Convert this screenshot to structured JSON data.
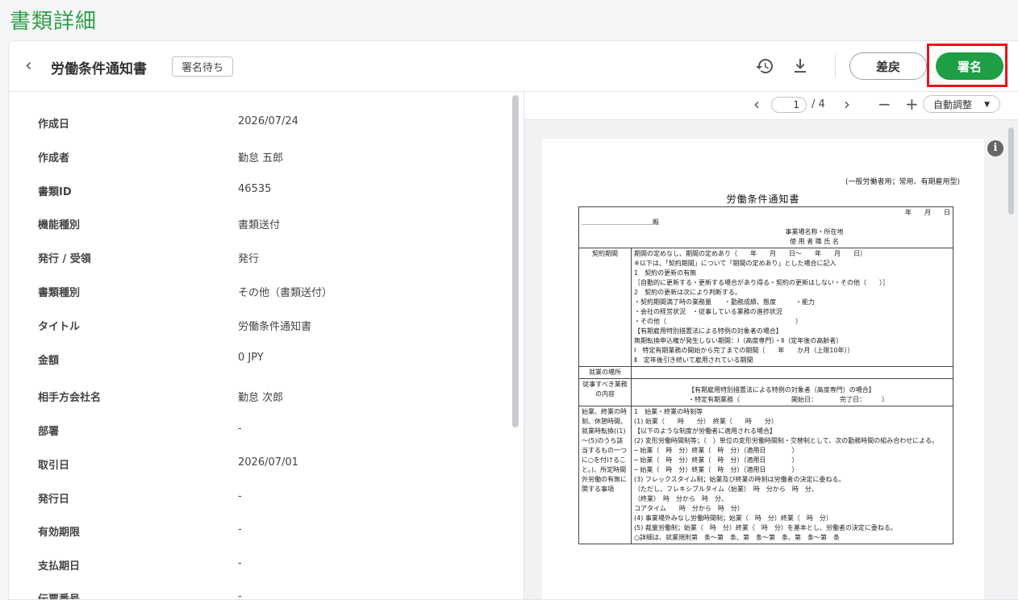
{
  "page_title": "書類詳細",
  "header": {
    "document_title": "労働条件通知書",
    "status_badge": "署名待ち",
    "return_label": "差戻",
    "sign_label": "署名"
  },
  "details": [
    {
      "key": "作成日",
      "value": "2026/07/24"
    },
    {
      "key": "作成者",
      "value": "勤怠 五郎"
    },
    {
      "key": "書類ID",
      "value": "46535"
    },
    {
      "key": "機能種別",
      "value": "書類送付"
    },
    {
      "key": "発行 / 受領",
      "value": "発行"
    },
    {
      "key": "書類種別",
      "value": "その他（書類送付）"
    },
    {
      "key": "タイトル",
      "value": "労働条件通知書"
    },
    {
      "key": "金額",
      "value": "0 JPY"
    },
    {
      "key": "相手方会社名",
      "value": "勤怠 次郎"
    },
    {
      "key": "部署",
      "value": "-"
    },
    {
      "key": "取引日",
      "value": "2026/07/01"
    },
    {
      "key": "発行日",
      "value": "-"
    },
    {
      "key": "有効期限",
      "value": "-"
    },
    {
      "key": "支払期日",
      "value": "-"
    },
    {
      "key": "伝票番号",
      "value": "-"
    }
  ],
  "viewer": {
    "current_page": "1",
    "total_pages": "/ 4",
    "zoom_label": "自動調整",
    "document": {
      "type_note": "(一般労働者用；常用、有期雇用型)",
      "heading": "労働条件通知書",
      "date_line": "年　　月　　日",
      "addressee": "＿＿＿＿＿＿＿＿＿＿＿殿",
      "employer_1": "事業場名称・所在地",
      "employer_2": "使 用 者 職 氏 名",
      "contract_label": "契約期間",
      "contract_lines": [
        "期間の定めなし、期間の定めあり（　　年　　月　　日～　　年　　月　　日）",
        "※以下は、「契約期間」について「期間の定めあり」とした場合に記入",
        "1　契約の更新の有無",
        "［自動的に更新する・更新する場合があり得る・契約の更新はしない・その他（　　）］",
        "2　契約の更新は次により判断する。",
        "・契約期間満了時の業務量　　・勤務成績、態度　　　・能力",
        "・会社の経営状況　・従事している業務の進捗状況",
        "・その他（　　　　　　　　　　　　　　　　　　　　）",
        "【有期雇用特別措置法による特例の対象者の場合】",
        "無期転換申込権が発生しない期間：Ⅰ（高度専門）・Ⅱ（定年後の高齢者）",
        "Ⅰ　特定有期業務の開始から完了までの期間（　　年　　か月（上限10年））",
        "Ⅱ　定年後引き続いて雇用されている期間"
      ],
      "workplace_label": "就業の場所",
      "duties_label": "従事すべき業務の内容",
      "duties_lines": [
        "【有期雇用特別措置法による特例の対象者（高度専門）の場合】",
        "・特定有期業務（　　　　　　　　開始日：　　　　完了日：　　　）"
      ],
      "hours_label": "始業、終業の時刻、休憩時間、就業時転換((1)～(5)のうち該当するもの一つに○を付けること。)、所定時間外労働の有無に関する事項",
      "hours_lines": [
        "1　始業・終業の時刻等",
        "(1) 始業（　　時　　分）　終業（　　時　　分）",
        "【以下のような制度が労働者に適用される場合】",
        "(2) 変形労働時間制等；（　）単位の変形労働時間制・交替制として、次の勤務時間の組み合わせによる。",
        "─ 始業（　時　分）終業（　時　分）（適用日　　　　）",
        "─ 始業（　時　分）終業（　時　分）（適用日　　　　）",
        "─ 始業（　時　分）終業（　時　分）（適用日　　　　）",
        "(3) フレックスタイム制；始業及び終業の時刻は労働者の決定に委ねる。",
        "（ただし、フレキシブルタイム（始業）　時　分から　時　分、",
        "（終業）　時　分から　時　分、",
        "コアタイム　　時　分から　時　分）",
        "(4) 事業場外みなし労働時間制；始業（　時　分）終業（　時　分）",
        "(5) 裁量労働制；始業（　時　分）終業（　時　分）を基本とし、労働者の決定に委ねる。",
        "○詳細は、就業規則第　条～第　条、第　条～第　条、第　条～第　条"
      ]
    }
  },
  "colors": {
    "accent": "#2ea04a",
    "sign_button": "#1e9e45",
    "highlight_border": "#e4161c"
  }
}
